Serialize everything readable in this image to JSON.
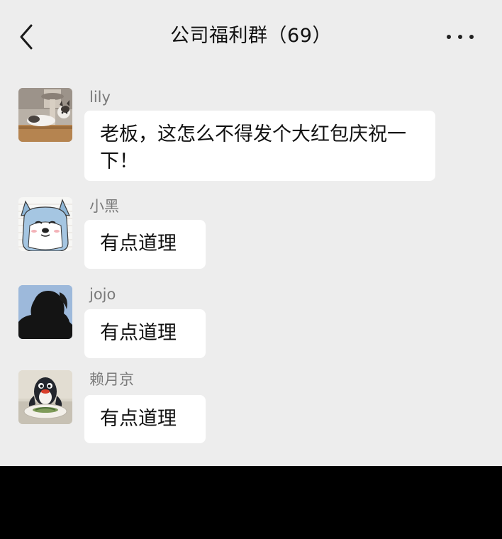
{
  "header": {
    "title": "公司福利群（69）"
  },
  "messages": [
    {
      "sender": "lily",
      "text": "老板，这怎么不得发个大红包庆祝一下！",
      "avatar": "cat-avatar"
    },
    {
      "sender": "小黑",
      "text": "有点道理",
      "avatar": "dog-avatar"
    },
    {
      "sender": "jojo",
      "text": "有点道理",
      "avatar": "silhouette-avatar"
    },
    {
      "sender": "赖月京",
      "text": "有点道理",
      "avatar": "penguin-avatar"
    }
  ],
  "colors": {
    "background": "#ededed",
    "bubble": "#ffffff",
    "sender_text": "#7a7a7a",
    "bottom_bar": "#000000"
  }
}
